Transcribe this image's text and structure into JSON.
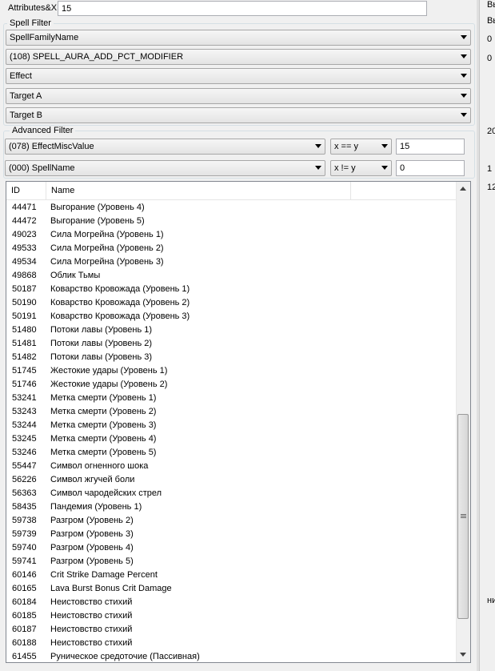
{
  "attributes": {
    "label": "Attributes&X:",
    "value": "15"
  },
  "spell_filter": {
    "title": "Spell Filter",
    "family": "SpellFamilyName",
    "aura": "(108) SPELL_AURA_ADD_PCT_MODIFIER",
    "effect": "Effect",
    "target_a": "Target A",
    "target_b": "Target B"
  },
  "advanced_filter": {
    "title": "Advanced Filter",
    "field1": "(078) EffectMiscValue",
    "op1": "x == y",
    "val1": "15",
    "field2": "(000) SpellName",
    "op2": "x != y",
    "val2": "0"
  },
  "list": {
    "columns": [
      "ID",
      "Name"
    ],
    "rows": [
      [
        "44471",
        "Выгорание (Уровень 4)"
      ],
      [
        "44472",
        "Выгорание (Уровень 5)"
      ],
      [
        "49023",
        "Сила Могрейна (Уровень 1)"
      ],
      [
        "49533",
        "Сила Могрейна (Уровень 2)"
      ],
      [
        "49534",
        "Сила Могрейна (Уровень 3)"
      ],
      [
        "49868",
        "Облик Тьмы"
      ],
      [
        "50187",
        "Коварство Кровожада (Уровень 1)"
      ],
      [
        "50190",
        "Коварство Кровожада (Уровень 2)"
      ],
      [
        "50191",
        "Коварство Кровожада (Уровень 3)"
      ],
      [
        "51480",
        "Потоки лавы (Уровень 1)"
      ],
      [
        "51481",
        "Потоки лавы (Уровень 2)"
      ],
      [
        "51482",
        "Потоки лавы (Уровень 3)"
      ],
      [
        "51745",
        "Жестокие удары (Уровень 1)"
      ],
      [
        "51746",
        "Жестокие удары (Уровень 2)"
      ],
      [
        "53241",
        "Метка смерти (Уровень 1)"
      ],
      [
        "53243",
        "Метка смерти (Уровень 2)"
      ],
      [
        "53244",
        "Метка смерти (Уровень 3)"
      ],
      [
        "53245",
        "Метка смерти (Уровень 4)"
      ],
      [
        "53246",
        "Метка смерти (Уровень 5)"
      ],
      [
        "55447",
        "Символ огненного шока"
      ],
      [
        "56226",
        "Символ жгучей боли"
      ],
      [
        "56363",
        "Символ чародейских стрел"
      ],
      [
        "58435",
        "Пандемия (Уровень 1)"
      ],
      [
        "59738",
        "Разгром (Уровень 2)"
      ],
      [
        "59739",
        "Разгром (Уровень 3)"
      ],
      [
        "59740",
        "Разгром (Уровень 4)"
      ],
      [
        "59741",
        "Разгром (Уровень 5)"
      ],
      [
        "60146",
        "Crit Strike Damage Percent"
      ],
      [
        "60165",
        "Lava Burst Bonus Crit Damage"
      ],
      [
        "60184",
        "Неистовство стихий"
      ],
      [
        "60185",
        "Неистовство стихий"
      ],
      [
        "60187",
        "Неистовство стихий"
      ],
      [
        "60188",
        "Неистовство стихий"
      ],
      [
        "61455",
        "Руническое средоточие (Пассивная)"
      ]
    ]
  },
  "right_panel": [
    "Вы",
    "Вы",
    "0",
    "0",
    "20",
    "1",
    "12",
    "ни"
  ]
}
